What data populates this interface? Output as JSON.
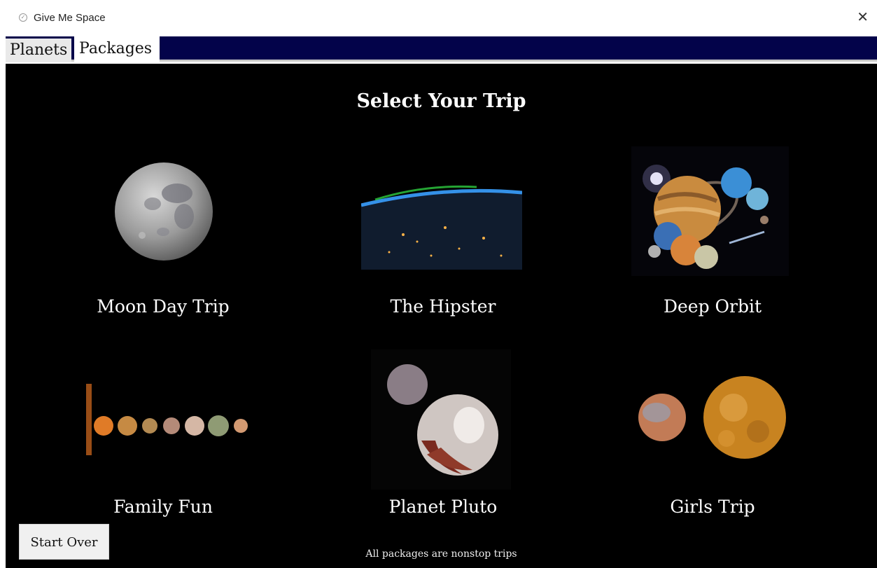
{
  "window": {
    "title": "Give Me Space",
    "close_symbol": "✕"
  },
  "tabs": [
    {
      "label": "Planets",
      "selected": false
    },
    {
      "label": "Packages",
      "selected": true
    }
  ],
  "main": {
    "heading": "Select Your Trip",
    "packages": [
      {
        "label": "Moon Day Trip",
        "image": "moon"
      },
      {
        "label": "The Hipster",
        "image": "earth-orbit-night"
      },
      {
        "label": "Deep Orbit",
        "image": "solar-system-collage"
      },
      {
        "label": "Family Fun",
        "image": "planet-lineup"
      },
      {
        "label": "Planet Pluto",
        "image": "pluto-and-charon"
      },
      {
        "label": "Girls Trip",
        "image": "mars-and-venus"
      }
    ],
    "start_over_label": "Start Over",
    "footer_note": "All packages are nonstop trips"
  },
  "colors": {
    "tab_bar": "#03034a",
    "content_bg": "#000000",
    "text": "#ffffff"
  }
}
